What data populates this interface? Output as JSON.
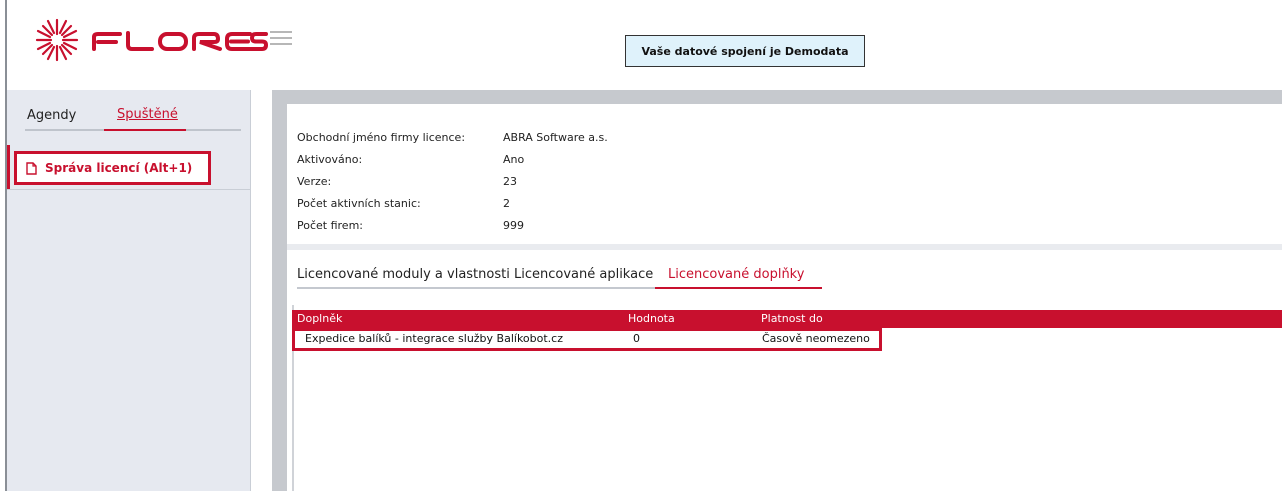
{
  "header": {
    "brand_name": "FLORES",
    "brand_color": "#c8102e",
    "connection_banner": "Vaše datové spojení je Demodata"
  },
  "sidebar": {
    "tabs": [
      {
        "label": "Agendy",
        "active": false
      },
      {
        "label": "Spuštěné",
        "active": true
      }
    ],
    "running_items": [
      {
        "label": "Správa licencí (Alt+1)",
        "icon": "document-icon"
      }
    ]
  },
  "license_info": [
    {
      "label": "Obchodní jméno firmy licence:",
      "value": "ABRA Software a.s."
    },
    {
      "label": "Aktivováno:",
      "value": "Ano"
    },
    {
      "label": "Verze:",
      "value": "23"
    },
    {
      "label": "Počet aktivních stanic:",
      "value": "2"
    },
    {
      "label": "Počet firem:",
      "value": "999"
    }
  ],
  "subtabs": [
    {
      "label": "Licencované moduly a vlastnosti",
      "active": false
    },
    {
      "label": "Licencované aplikace",
      "active": false
    },
    {
      "label": "Licencované doplňky",
      "active": true
    }
  ],
  "grid": {
    "columns": [
      "Doplněk",
      "Hodnota",
      "Platnost do"
    ],
    "rows": [
      {
        "doplnek": "Expedice balíků - integrace služby Balíkobot.cz",
        "hodnota": "0",
        "platnost": "Časově neomezeno"
      }
    ]
  }
}
